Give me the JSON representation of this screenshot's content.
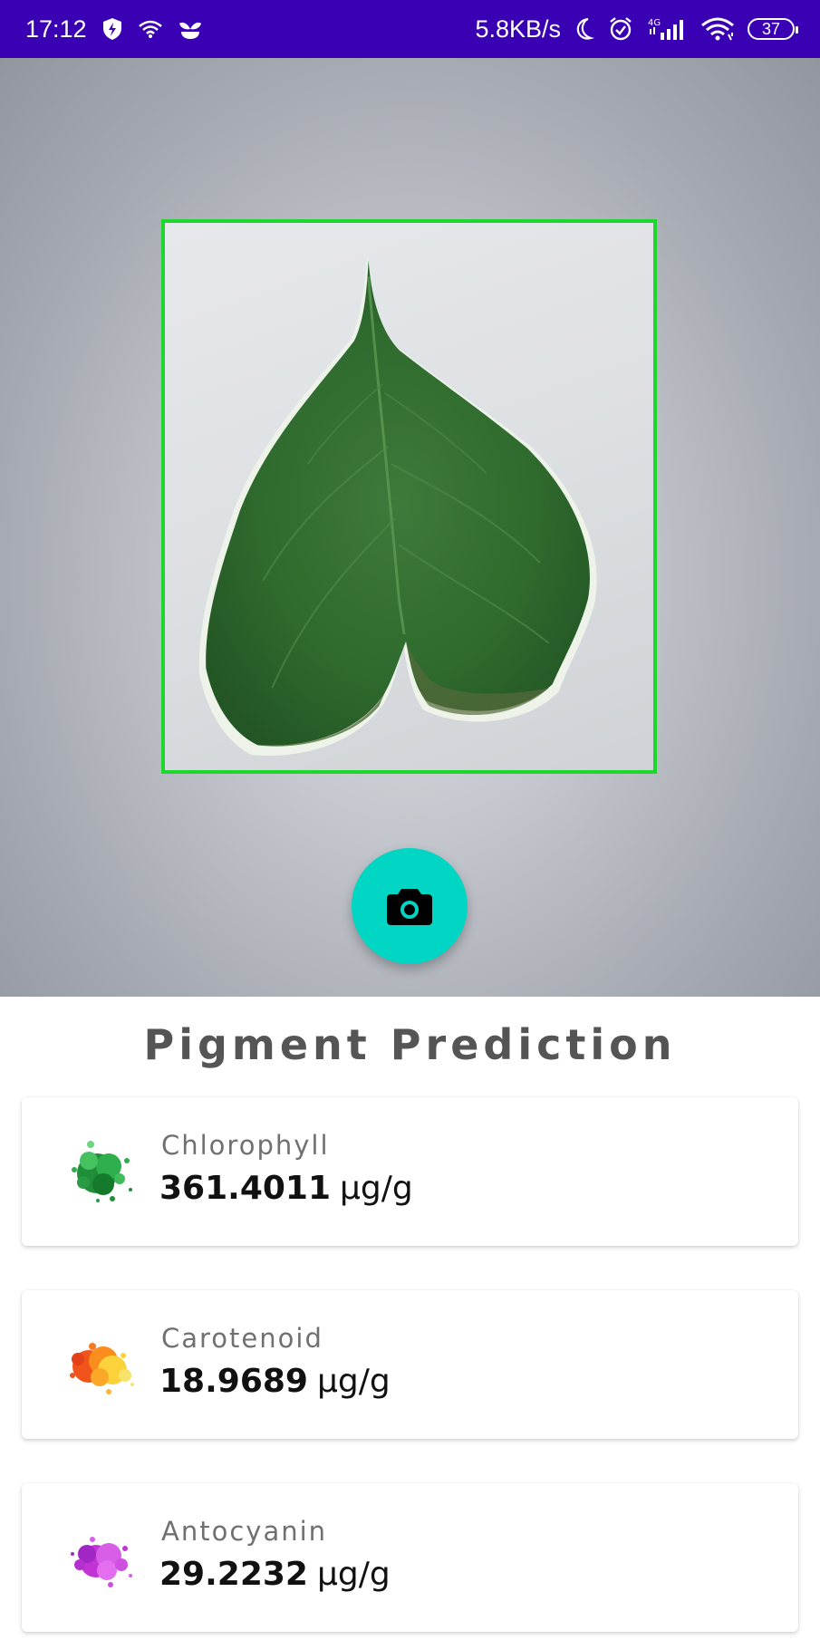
{
  "status_bar": {
    "time": "17:12",
    "net_speed": "5.8KB/s",
    "network_type": "4G",
    "battery": "37",
    "icons_left": [
      "shield-bolt-icon",
      "wifi-hotspot-icon",
      "plant-sprout-icon"
    ],
    "icons_right": [
      "moon-icon",
      "alarm-icon",
      "cell-signal-icon",
      "wifi-icon",
      "battery-icon"
    ]
  },
  "camera": {
    "frame_color": "#1ed62e",
    "shutter_color": "#00d6c3",
    "shutter_icon": "camera-icon"
  },
  "results": {
    "title": "Pigment Prediction",
    "items": [
      {
        "name": "Chlorophyll",
        "value": "361.4011",
        "unit": "µg/g",
        "icon": "green-paint-splash-icon"
      },
      {
        "name": "Carotenoid",
        "value": "18.9689",
        "unit": "µg/g",
        "icon": "orange-paint-splash-icon"
      },
      {
        "name": "Antocyanin",
        "value": "29.2232",
        "unit": "µg/g",
        "icon": "purple-paint-splash-icon"
      }
    ]
  },
  "colors": {
    "status_bar": "#3a00b4",
    "title_text": "#555555"
  }
}
